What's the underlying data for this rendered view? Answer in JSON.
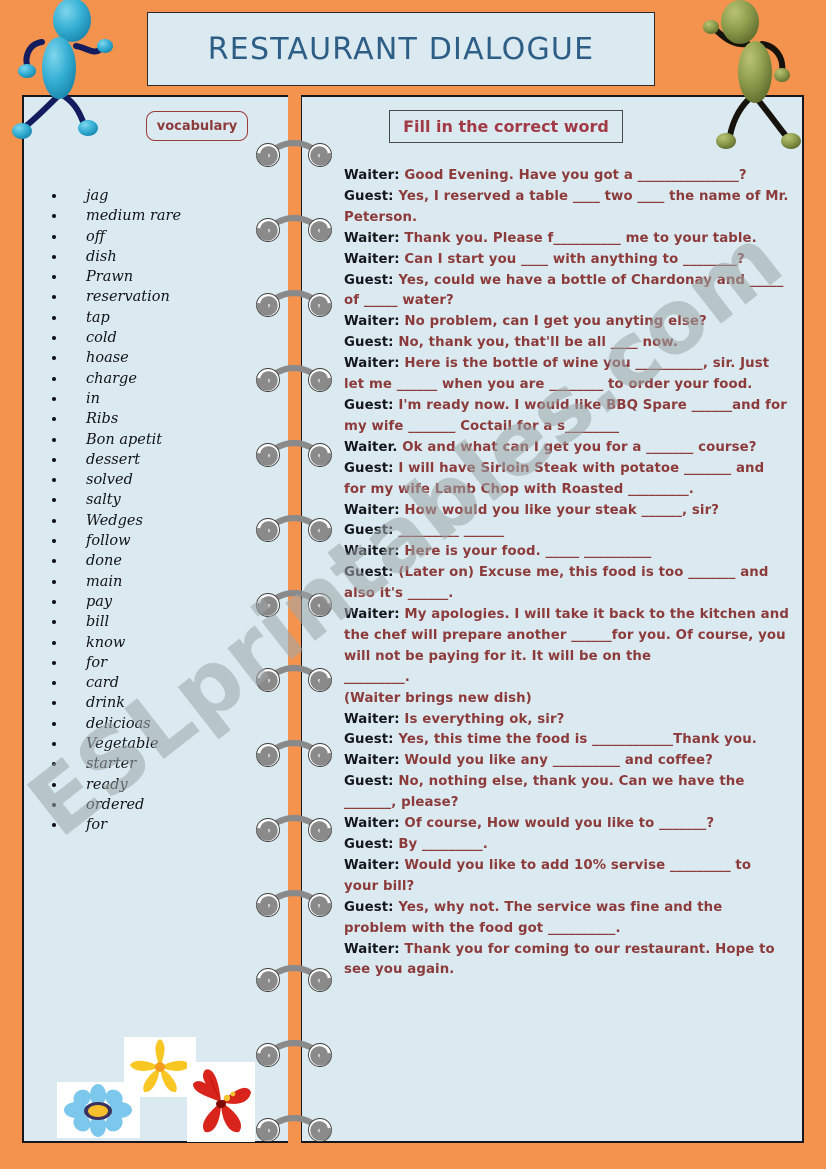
{
  "document": {
    "title": "RESTAURANT DIALOGUE",
    "watermark": "ESLprintables.com",
    "colors": {
      "page_background": "#F4934E",
      "panel_background": "#DAEAF0",
      "panel_border": "#16171C",
      "title_text": "#2E5E86",
      "dialogue_text": "#8C3A3A",
      "speaker_text": "#14161C",
      "vocab_label_border": "#9C3B3B",
      "spiral": "#8A8A8A"
    }
  },
  "left_panel": {
    "label": "vocabulary",
    "words": [
      "jag",
      "medium rare",
      "off",
      "dish",
      "Prawn",
      "reservation",
      "tap",
      "cold",
      "hoase",
      "charge",
      "in",
      "Ribs",
      "Bon apetit",
      "dessert",
      "solved",
      "salty",
      "Wedges",
      "follow",
      "done",
      "main",
      "pay",
      "bill",
      "know",
      "for",
      "card",
      "drink",
      "delicioas",
      "Vegetable",
      "starter",
      "ready",
      "ordered",
      "for"
    ]
  },
  "right_panel": {
    "label": "Fill in the correct word",
    "dialogue": [
      {
        "speaker": "Waiter:",
        "text": " Good Evening. Have you got a _______________?"
      },
      {
        "speaker": "Guest:",
        "text": " Yes, I reserved a table ____   two ____   the name of Mr. Peterson."
      },
      {
        "speaker": "Waiter:",
        "text": " Thank you.  Please f__________ me to your table."
      },
      {
        "speaker": "Waiter:",
        "text": " Can I start you ____ with anything to ________?"
      },
      {
        "speaker": "Guest:",
        "text": " Yes, could we have a bottle of Chardonay and _____ of _____ water?"
      },
      {
        "speaker": "Waiter:",
        "text": " No problem, can I get you anyting else?"
      },
      {
        "speaker": "Guest:",
        "text": " No, thank you, that'll be all ____ now."
      },
      {
        "speaker": "Waiter:",
        "text": " Here is the bottle of wine you __________, sir. Just let me ______ when you are ________ to order your food."
      },
      {
        "speaker": "Guest:",
        "text": " I'm ready now. I would like BBQ Spare ______and for my wife _______ Coctail for a s________"
      },
      {
        "speaker": "Waiter.",
        "text": " Ok and what can I get you for a _______ course?"
      },
      {
        "speaker": "Guest:",
        "text": " I will have Sirloin Steak with potatoe _______ and for my wife Lamb Chop with Roasted _________."
      },
      {
        "speaker": "Waiter:",
        "text": " How would you like your steak ______, sir?"
      },
      {
        "speaker": "Guest:",
        "text": " _________ ______"
      },
      {
        "speaker": "Waiter:",
        "text": " Here is your food. _____ __________"
      },
      {
        "speaker": "Guest:",
        "text": " (Later on) Excuse me, this food is too _______ and also it's ______."
      },
      {
        "speaker": "Waiter:",
        "text": " My apologies. I will take it back to the kitchen and the chef will prepare another ______for you. Of course, you will not be paying for it. It will be on the"
      },
      {
        "speaker": "",
        "text": "_________."
      },
      {
        "speaker": "",
        "text": "(Waiter brings new dish)"
      },
      {
        "speaker": "Waiter:",
        "text": " Is everything ok, sir?"
      },
      {
        "speaker": "Guest:",
        "text": " Yes, this time the food is ____________Thank you."
      },
      {
        "speaker": "Waiter:",
        "text": " Would you like any __________ and coffee?"
      },
      {
        "speaker": "Guest:",
        "text": " No, nothing else, thank you. Can we have the _______, please?"
      },
      {
        "speaker": "Waiter:",
        "text": " Of course, How would you like to _______?"
      },
      {
        "speaker": "Guest:",
        "text": " By _________."
      },
      {
        "speaker": "Waiter:",
        "text": " Would you like to add 10% servise _________ to your bill?"
      },
      {
        "speaker": "Guest:",
        "text": " Yes, why not. The service was fine and the problem with the food got __________."
      },
      {
        "speaker": "Waiter:",
        "text": " Thank you for coming to our restaurant. Hope to see you again."
      }
    ]
  },
  "decorations": {
    "figures": [
      {
        "name": "blue-stick-figure",
        "color": "#35AFD4"
      },
      {
        "name": "green-stick-figure",
        "color": "#8A9A4B"
      }
    ],
    "flowers": [
      {
        "name": "blue-daisy",
        "color": "#77C3E8"
      },
      {
        "name": "yellow-flower",
        "color": "#F5B323"
      },
      {
        "name": "red-hibiscus",
        "color": "#D22B1E"
      }
    ],
    "spiral_rings": 14
  }
}
